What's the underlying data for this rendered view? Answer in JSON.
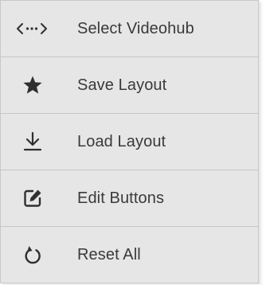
{
  "menu": {
    "items": [
      {
        "label": "Select Videohub",
        "icon": "select-videohub-arrows-icon"
      },
      {
        "label": "Save Layout",
        "icon": "star-icon"
      },
      {
        "label": "Load Layout",
        "icon": "download-arrow-icon"
      },
      {
        "label": "Edit Buttons",
        "icon": "edit-pencil-icon"
      },
      {
        "label": "Reset All",
        "icon": "reset-circular-arrow-icon"
      }
    ]
  },
  "colors": {
    "background": "#e6e6e6",
    "divider": "#c6c6c6",
    "text": "#3a3a3a",
    "icon": "#2f2f2f"
  }
}
